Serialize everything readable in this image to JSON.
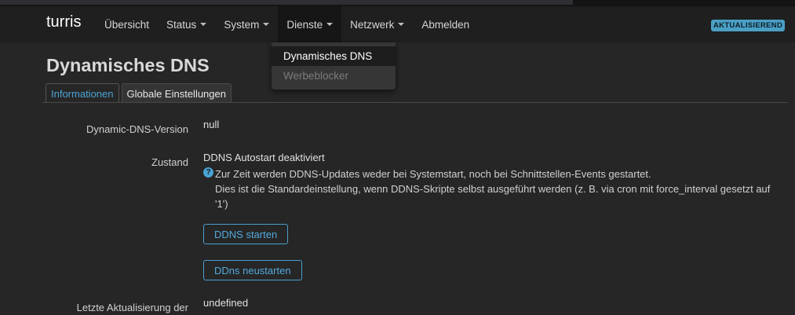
{
  "header": {
    "brand": "turris",
    "nav": [
      {
        "label": "Übersicht"
      },
      {
        "label": "Status"
      },
      {
        "label": "System"
      },
      {
        "label": "Dienste"
      },
      {
        "label": "Netzwerk"
      },
      {
        "label": "Abmelden"
      }
    ],
    "badge": "AKTUALISIEREND"
  },
  "dropdown": {
    "items": [
      {
        "label": "Dynamisches DNS"
      },
      {
        "label": "Werbeblocker"
      }
    ]
  },
  "page": {
    "title": "Dynamisches DNS",
    "tabs": [
      {
        "label": "Informationen"
      },
      {
        "label": "Globale Einstellungen"
      }
    ]
  },
  "fields": {
    "version": {
      "label": "Dynamic-DNS-Version",
      "value": "null"
    },
    "state": {
      "label": "Zustand",
      "value": "DDNS Autostart deaktiviert",
      "help_line1": "Zur Zeit werden DDNS-Updates weder bei Systemstart, noch bei Schnittstellen-Events gestartet.",
      "help_line2": "Dies ist die Standardeinstellung, wenn DDNS-Skripte selbst ausgeführt werden (z. B. via cron mit force_interval gesetzt auf '1')"
    },
    "start_button": "DDNS starten",
    "restart_button": "DDns neustarten",
    "last_update": {
      "label": "Letzte Aktualisierung der",
      "value": "undefined"
    }
  },
  "colors": {
    "accent": "#4ca3d4",
    "badge": "#4a9fc4",
    "background": "#262626",
    "navbar": "#1f1f1f"
  }
}
